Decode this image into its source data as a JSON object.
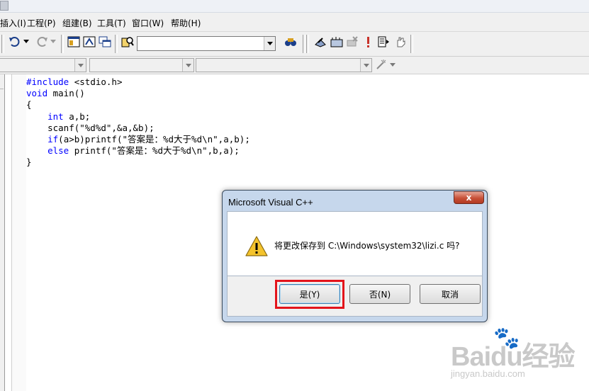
{
  "menu": {
    "items": [
      "插入(I)",
      "工程(P)",
      "组建(B)",
      "工具(T)",
      "窗口(W)",
      "帮助(H)"
    ]
  },
  "toolbar": {
    "undo_icon": "undo-icon",
    "redo_icon": "redo-icon",
    "find_combo_value": ""
  },
  "editor": {
    "lines": [
      [
        {
          "t": "#include",
          "k": true
        },
        {
          "t": " <stdio.h>",
          "k": false
        }
      ],
      [
        {
          "t": "void",
          "k": true
        },
        {
          "t": " main()",
          "k": false
        }
      ],
      [
        {
          "t": "{",
          "k": false
        }
      ],
      [
        {
          "t": "    ",
          "k": false
        },
        {
          "t": "int",
          "k": true
        },
        {
          "t": " a,b;",
          "k": false
        }
      ],
      [
        {
          "t": "    scanf(\"%d%d\",&a,&b);",
          "k": false
        }
      ],
      [
        {
          "t": "    ",
          "k": false
        },
        {
          "t": "if",
          "k": true
        },
        {
          "t": "(a>b)printf(\"答案是：%d大于%d\\n\",a,b);",
          "k": false
        }
      ],
      [
        {
          "t": "    ",
          "k": false
        },
        {
          "t": "else",
          "k": true
        },
        {
          "t": " printf(\"答案是：%d大于%d\\n\",b,a);",
          "k": false
        }
      ],
      [
        {
          "t": "}",
          "k": false
        }
      ]
    ],
    "keyword_color": "#0000ff"
  },
  "dialog": {
    "title": "Microsoft Visual C++",
    "close_label": "x",
    "message": "将更改保存到 C:\\Windows\\system32\\lizi.c 吗?",
    "yes_label": "是(Y)",
    "no_label": "否(N)",
    "cancel_label": "取消",
    "highlight_color": "#e3141b"
  },
  "watermark": {
    "brand": "Baidu经验",
    "url": "jingyan.baidu.com"
  }
}
